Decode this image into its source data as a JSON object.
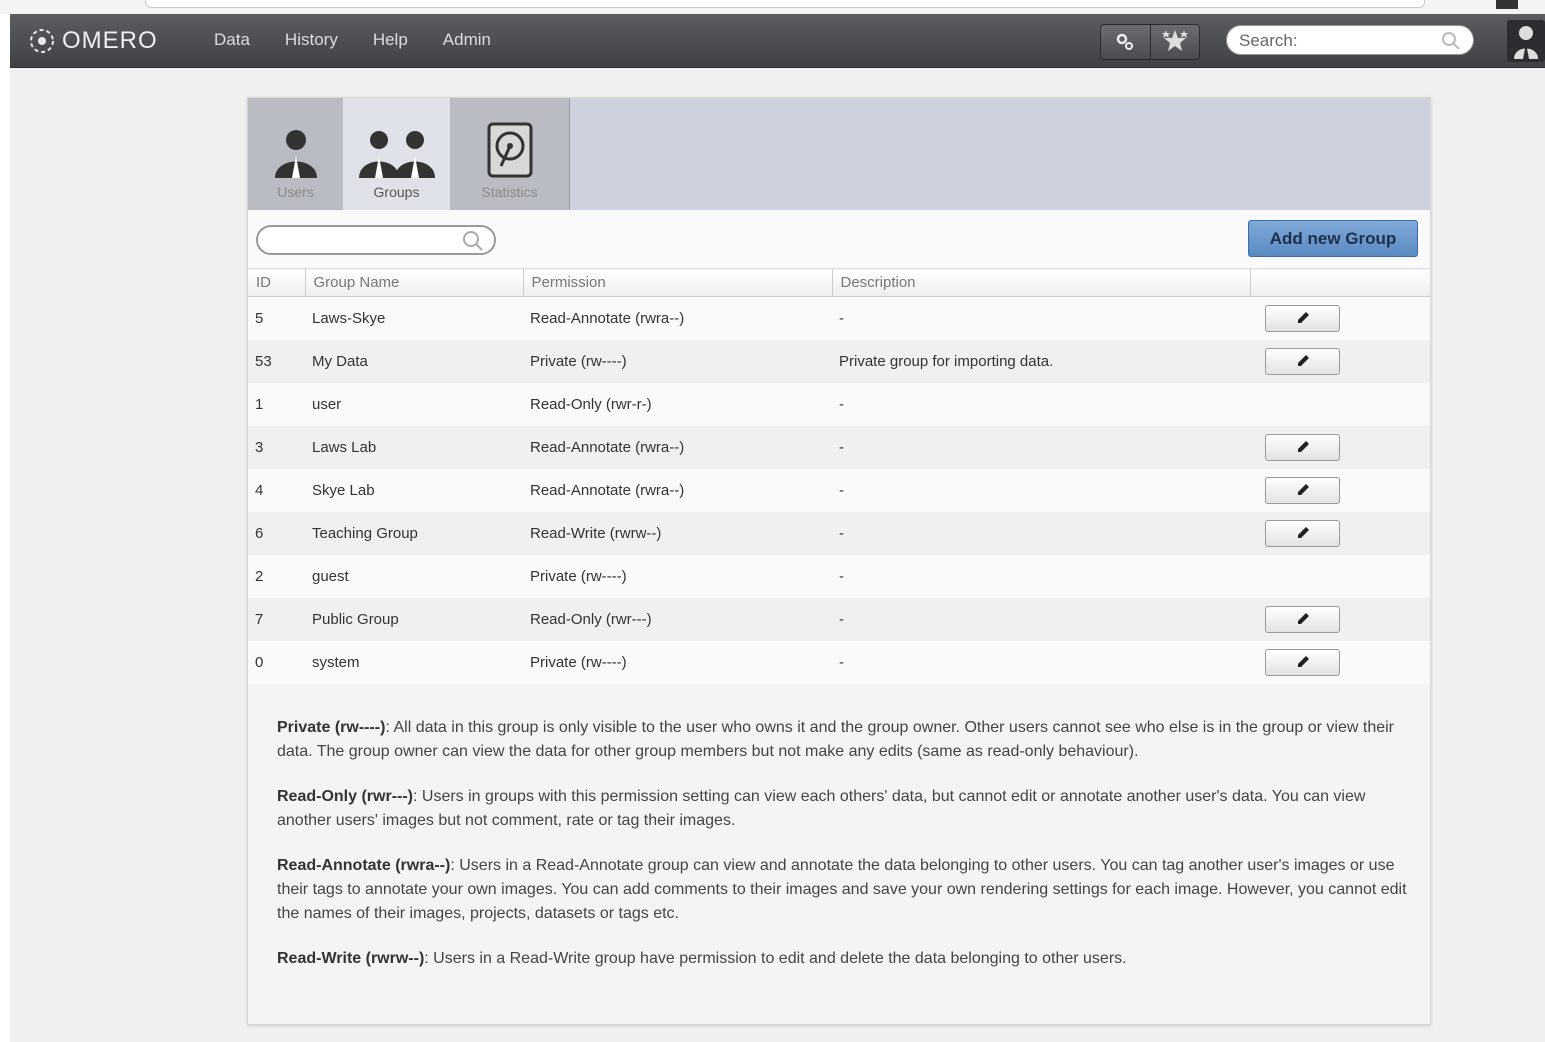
{
  "header": {
    "app_name": "OMERO",
    "nav": [
      "Data",
      "History",
      "Help",
      "Admin"
    ],
    "search_placeholder": "Search:"
  },
  "tabs": [
    {
      "label": "Users"
    },
    {
      "label": "Groups"
    },
    {
      "label": "Statistics"
    }
  ],
  "toolbar": {
    "add_label": "Add new Group"
  },
  "table": {
    "columns": [
      "ID",
      "Group Name",
      "Permission",
      "Description",
      ""
    ],
    "rows": [
      {
        "id": "5",
        "name": "Laws-Skye",
        "permission": "Read-Annotate (rwra--)",
        "description": "-",
        "editable": true
      },
      {
        "id": "53",
        "name": "My Data",
        "permission": "Private (rw----)",
        "description": "Private group for importing data.",
        "editable": true
      },
      {
        "id": "1",
        "name": "user",
        "permission": "Read-Only (rwr-r-)",
        "description": "-",
        "editable": false
      },
      {
        "id": "3",
        "name": "Laws Lab",
        "permission": "Read-Annotate (rwra--)",
        "description": "-",
        "editable": true
      },
      {
        "id": "4",
        "name": "Skye Lab",
        "permission": "Read-Annotate (rwra--)",
        "description": "-",
        "editable": true
      },
      {
        "id": "6",
        "name": "Teaching Group",
        "permission": "Read-Write (rwrw--)",
        "description": "-",
        "editable": true
      },
      {
        "id": "2",
        "name": "guest",
        "permission": "Private (rw----)",
        "description": "-",
        "editable": false
      },
      {
        "id": "7",
        "name": "Public Group",
        "permission": "Read-Only (rwr---)",
        "description": "-",
        "editable": true
      },
      {
        "id": "0",
        "name": "system",
        "permission": "Private (rw----)",
        "description": "-",
        "editable": true
      }
    ]
  },
  "legend": [
    {
      "term": "Private (rw----)",
      "text": ": All data in this group is only visible to the user who owns it and the group owner. Other users cannot see who else is in the group or view their data. The group owner can view the data for other group members but not make any edits (same as read-only behaviour)."
    },
    {
      "term": "Read-Only (rwr---)",
      "text": ": Users in groups with this permission setting can view each others' data, but cannot edit or annotate another user's data. You can view another users' images but not comment, rate or tag their images."
    },
    {
      "term": "Read-Annotate (rwra--)",
      "text": ": Users in a Read-Annotate group can view and annotate the data belonging to other users. You can tag another user's images or use their tags to annotate your own images. You can add comments to their images and save your own rendering settings for each image. However, you cannot edit the names of their images, projects, datasets or tags etc."
    },
    {
      "term": "Read-Write (rwrw--)",
      "text": ": Users in a Read-Write group have permission to edit and delete the data belonging to other users."
    }
  ]
}
